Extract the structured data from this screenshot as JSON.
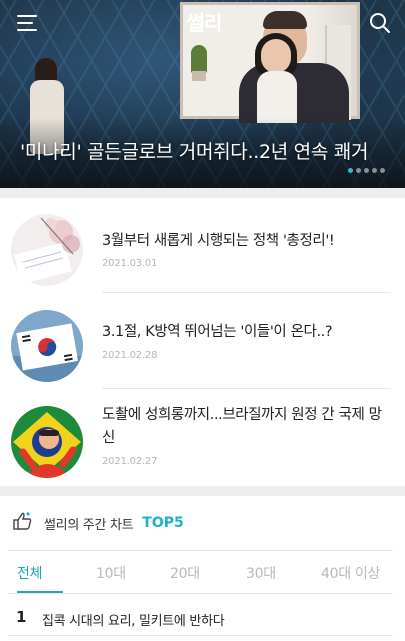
{
  "header": {
    "logo_text": "썰리",
    "menu_icon": "hamburger-menu-icon",
    "search_icon": "search-icon"
  },
  "hero": {
    "title": "'미나리' 골든글로브 거머쥐다..2년 연속 쾌거",
    "slide_count": 5,
    "active_slide": 1,
    "accent_color": "#3cb7c9"
  },
  "articles": [
    {
      "title": "3월부터 새롭게 시행되는 정책 '총정리'!",
      "date": "2021.03.01"
    },
    {
      "title": "3.1절, K방역 뛰어넘는 '이들'이 온다..?",
      "date": "2021.02.28"
    },
    {
      "title": "도촬에 성희롱까지...브라질까지 원정 간 국제 망신",
      "date": "2021.02.27"
    }
  ],
  "weekly_chart": {
    "label": "썰리의 주간 차트",
    "badge": "TOP5",
    "tabs": [
      "전체",
      "10대",
      "20대",
      "30대",
      "40대 이상"
    ],
    "active_tab": 0,
    "items": [
      {
        "rank": "1",
        "title": "집콕 시대의 요리, 밀키트에 반하다"
      }
    ]
  },
  "colors": {
    "accent": "#1aa9bb",
    "date_gray": "#b7b7b7",
    "divider": "#eeeeee"
  }
}
